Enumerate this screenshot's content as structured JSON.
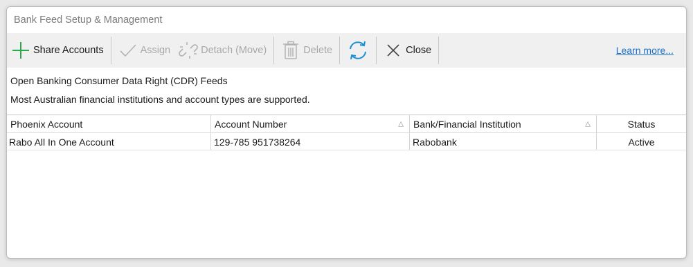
{
  "window": {
    "title": "Bank Feed Setup & Management"
  },
  "toolbar": {
    "share_label": "Share Accounts",
    "assign_label": "Assign",
    "detach_label": "Detach (Move)",
    "delete_label": "Delete",
    "close_label": "Close",
    "learn_more": "Learn more...",
    "accent_green": "#2aa84a",
    "accent_blue": "#1a8fd6"
  },
  "info": {
    "line1": "Open Banking Consumer Data Right (CDR) Feeds",
    "line2": "Most Australian financial institutions and account types are supported."
  },
  "grid": {
    "columns": [
      "Phoenix Account",
      "Account Number",
      "Bank/Financial Institution",
      "Status"
    ],
    "rows": [
      {
        "account": "Rabo All In One Account",
        "number": "129-785 951738264",
        "bank": "Rabobank",
        "status": "Active"
      }
    ]
  }
}
